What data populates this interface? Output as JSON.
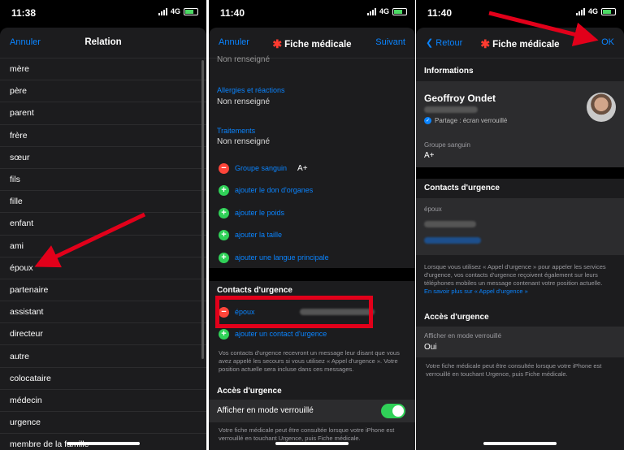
{
  "status": {
    "p1_time": "11:38",
    "p2_time": "11:40",
    "p3_time": "11:40",
    "network": "4G"
  },
  "p1": {
    "cancel": "Annuler",
    "title": "Relation",
    "items": [
      "mère",
      "père",
      "parent",
      "frère",
      "sœur",
      "fils",
      "fille",
      "enfant",
      "ami",
      "époux",
      "partenaire",
      "assistant",
      "directeur",
      "autre",
      "colocataire",
      "médecin",
      "urgence",
      "membre de la famille"
    ]
  },
  "p2": {
    "cancel": "Annuler",
    "title": "Fiche médicale",
    "next": "Suivant",
    "not_set_top": "Non renseigné",
    "allergies_label": "Allergies et réactions",
    "allergies_value": "Non renseigné",
    "treatments_label": "Traitements",
    "treatments_value": "Non renseigné",
    "blood_label": "Groupe sanguin",
    "blood_value": "A+",
    "add_organ": "ajouter le don d'organes",
    "add_weight": "ajouter le poids",
    "add_height": "ajouter la taille",
    "add_language": "ajouter une langue principale",
    "contacts_header": "Contacts d'urgence",
    "contact_relation": "époux",
    "add_contact": "ajouter un contact d'urgence",
    "contacts_note": "Vos contacts d'urgence recevront un message leur disant que vous avez appelé les secours si vous utilisez « Appel d'urgence ». Votre position actuelle sera incluse dans ces messages.",
    "access_header": "Accès d'urgence",
    "show_locked": "Afficher en mode verrouillé",
    "access_note": "Votre fiche médicale peut être consultée lorsque votre iPhone est verrouillé en touchant Urgence, puis Fiche médicale."
  },
  "p3": {
    "back": "Retour",
    "title": "Fiche médicale",
    "ok": "OK",
    "info_header": "Informations",
    "name": "Geoffroy Ondet",
    "sharing": "Partage : écran verrouillé",
    "blood_label": "Groupe sanguin",
    "blood_value": "A+",
    "contacts_header": "Contacts d'urgence",
    "contact_relation": "époux",
    "contacts_note": "Lorsque vous utilisez « Appel d'urgence » pour appeler les services d'urgence, vos contacts d'urgence reçoivent également sur leurs téléphones mobiles un message contenant votre position actuelle.",
    "learn_more": "En savoir plus sur « Appel d'urgence »",
    "access_header": "Accès d'urgence",
    "show_locked_label": "Afficher en mode verrouillé",
    "show_locked_value": "Oui",
    "access_note": "Votre fiche médicale peut être consultée lorsque votre iPhone est verrouillé en touchant Urgence, puis Fiche médicale."
  },
  "colors": {
    "accent": "#0a84ff",
    "annotation_red": "#e2001a",
    "toggle_on": "#30d158",
    "remove_red": "#ff453a"
  }
}
